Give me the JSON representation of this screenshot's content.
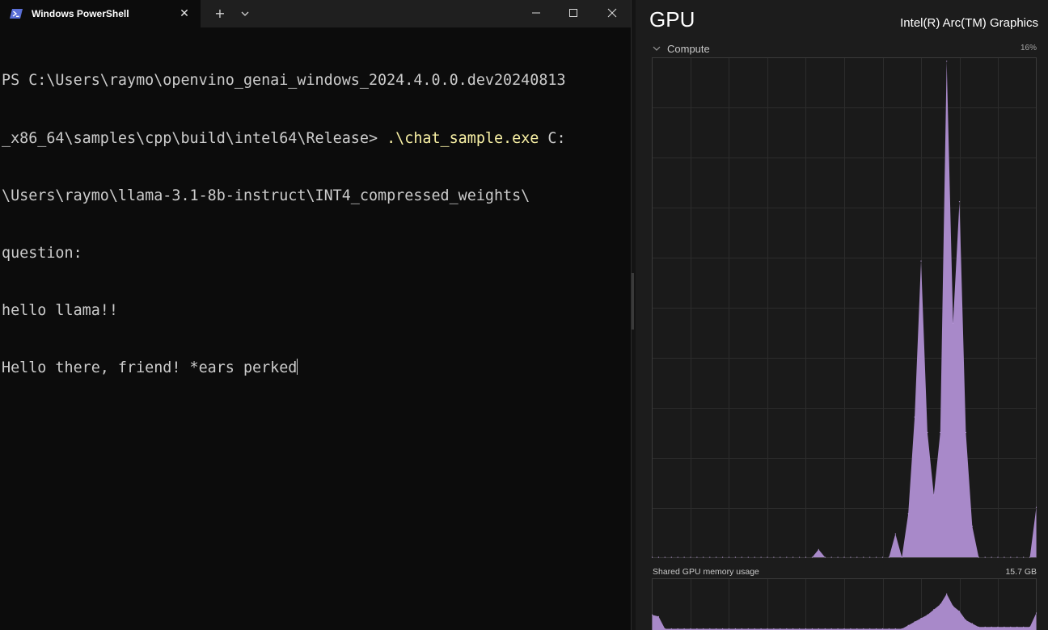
{
  "powershell": {
    "tab_title": "Windows PowerShell",
    "icons": {
      "tab": "powershell-icon",
      "close_tab": "close-icon",
      "new_tab": "plus-icon",
      "dropdown": "chevron-down-icon",
      "minimize": "minimize-icon",
      "maximize": "maximize-icon",
      "close": "close-icon"
    },
    "glyphs": {
      "close_tab": "✕",
      "new_tab": "+",
      "dropdown": "⌄"
    },
    "terminal": {
      "line1": "PS C:\\Users\\raymo\\openvino_genai_windows_2024.4.0.0.dev20240813",
      "line2_prefix": "_x86_64\\samples\\cpp\\build\\intel64\\Release> ",
      "line2_command": ".\\chat_sample.exe",
      "line2_suffix": " C:",
      "line3": "\\Users\\raymo\\llama-3.1-8b-instruct\\INT4_compressed_weights\\",
      "line4": "question:",
      "line5": "hello llama!!",
      "line6": "Hello there, friend! *ears perked"
    },
    "colors": {
      "background": "#0c0c0c",
      "text": "#cccccc",
      "command": "#f9f1a5",
      "titlebar": "#1f1f1f"
    }
  },
  "gpu_panel": {
    "title": "GPU",
    "device_name": "Intel(R) Arc(TM) Graphics",
    "compute_label": "Compute",
    "compute_max": "16%",
    "memory_label": "Shared GPU memory usage",
    "memory_max": "15.7 GB",
    "colors": {
      "background": "#1c1c1c",
      "graph_fill": "#a889c9",
      "graph_line": "#b99ad9",
      "grid": "#2c2c2c"
    }
  },
  "chart_data": [
    {
      "type": "area",
      "title": "Compute",
      "xlabel": "",
      "ylabel": "",
      "ylim": [
        0,
        16
      ],
      "grid": true,
      "x": [
        0,
        1,
        2,
        3,
        4,
        5,
        6,
        7,
        8,
        9,
        10,
        11,
        12,
        13,
        14,
        15,
        16,
        17,
        18,
        19,
        20,
        21,
        22,
        23,
        24,
        25,
        26,
        27,
        28,
        29,
        30,
        31,
        32,
        33,
        34,
        35,
        36,
        37,
        38,
        39,
        40,
        41,
        42,
        43,
        44,
        45,
        46,
        47,
        48,
        49,
        50,
        51,
        52,
        53,
        54,
        55,
        56,
        57,
        58,
        59,
        60
      ],
      "series": [
        {
          "values": [
            0,
            0,
            0,
            0,
            0,
            0,
            0,
            0,
            0,
            0,
            0,
            0,
            0,
            0,
            0,
            0,
            0,
            0,
            0,
            0,
            0,
            0,
            0,
            0,
            0,
            0,
            0.25,
            0,
            0,
            0,
            0,
            0,
            0,
            0,
            0,
            0,
            0,
            0,
            0.75,
            0,
            1.4,
            4.5,
            9.5,
            4.0,
            2.0,
            4.0,
            15.9,
            7.5,
            11.4,
            4.0,
            1.0,
            0,
            0,
            0,
            0,
            0,
            0,
            0,
            0,
            0,
            1.6
          ]
        }
      ]
    },
    {
      "type": "area",
      "title": "Shared GPU memory usage",
      "xlabel": "",
      "ylabel": "",
      "ylim": [
        0,
        15.7
      ],
      "grid": true,
      "x": [
        0,
        1,
        2,
        3,
        4,
        5,
        6,
        7,
        8,
        9,
        10,
        11,
        12,
        13,
        14,
        15,
        16,
        17,
        18,
        19,
        20,
        21,
        22,
        23,
        24,
        25,
        26,
        27,
        28,
        29,
        30,
        31,
        32,
        33,
        34,
        35,
        36,
        37,
        38,
        39,
        40,
        41,
        42,
        43,
        44,
        45,
        46,
        47,
        48,
        49,
        50,
        51,
        52,
        53,
        54,
        55,
        56,
        57,
        58,
        59,
        60
      ],
      "series": [
        {
          "values": [
            5.5,
            5.0,
            1.5,
            1.5,
            1.5,
            1.5,
            1.5,
            1.5,
            1.5,
            1.5,
            1.5,
            1.5,
            1.5,
            1.5,
            1.5,
            1.5,
            1.5,
            1.5,
            1.5,
            1.5,
            1.5,
            1.5,
            1.5,
            1.5,
            1.5,
            1.5,
            1.5,
            1.5,
            1.5,
            1.5,
            1.5,
            1.5,
            1.5,
            1.5,
            1.5,
            1.5,
            1.5,
            1.5,
            1.5,
            1.5,
            2.5,
            3.5,
            4.5,
            5.5,
            7.0,
            8.5,
            11.5,
            8.0,
            6.5,
            4.0,
            3.0,
            2.0,
            2.0,
            2.0,
            2.0,
            2.0,
            2.0,
            2.0,
            2.0,
            2.0,
            6.0
          ]
        }
      ]
    }
  ]
}
